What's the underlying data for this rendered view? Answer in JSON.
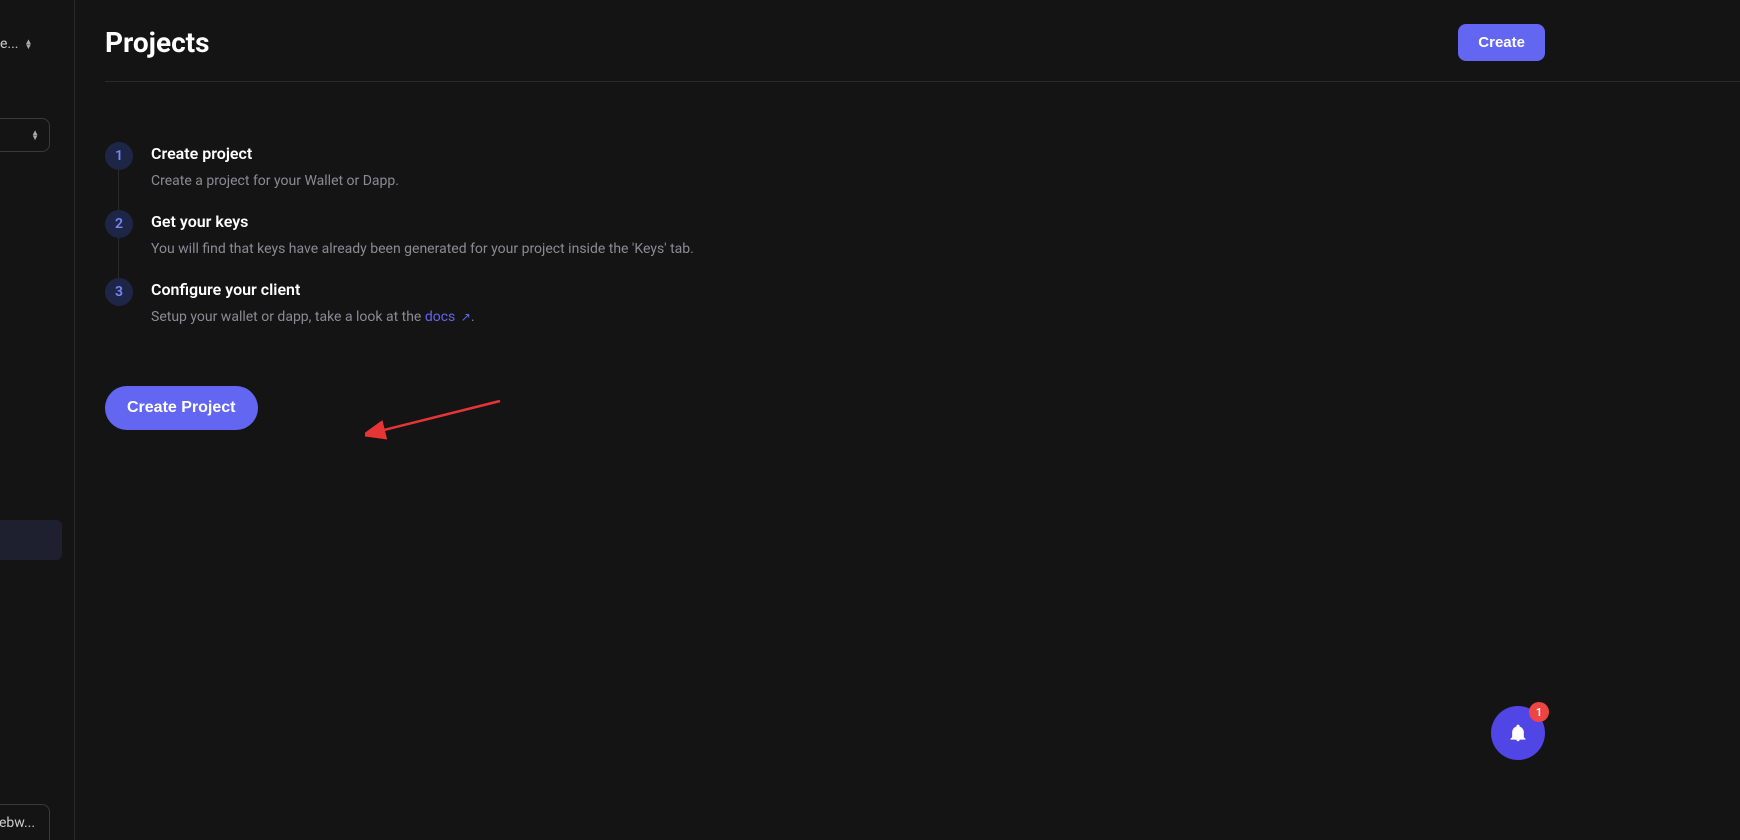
{
  "sidebar": {
    "top_selector": "e...",
    "bottom_selector": "ebw..."
  },
  "header": {
    "title": "Projects",
    "create_label": "Create"
  },
  "steps": [
    {
      "number": "1",
      "title": "Create project",
      "description": "Create a project for your Wallet or Dapp."
    },
    {
      "number": "2",
      "title": "Get your keys",
      "description": "You will find that keys have already been generated for your project inside the 'Keys' tab."
    },
    {
      "number": "3",
      "title": "Configure your client",
      "description_prefix": "Setup your wallet or dapp, take a look at the ",
      "description_link": "docs",
      "description_suffix": "."
    }
  ],
  "create_project_button": "Create Project",
  "notification": {
    "count": "1"
  },
  "colors": {
    "accent": "#6366f1",
    "background": "#141414",
    "text_muted": "#8b8b94",
    "badge": "#ef4444"
  }
}
